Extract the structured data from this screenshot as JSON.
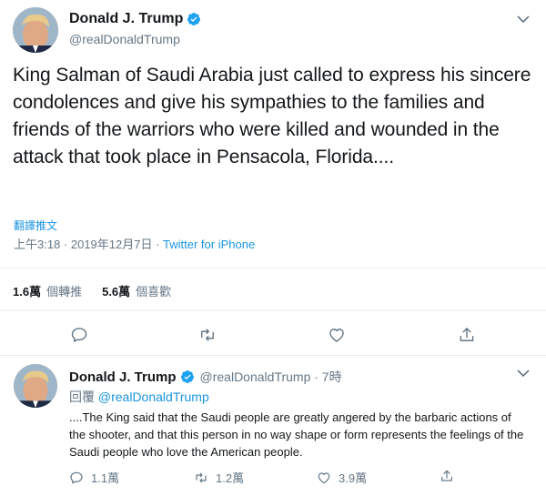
{
  "main_tweet": {
    "display_name": "Donald J. Trump",
    "handle": "@realDonaldTrump",
    "text": "King Salman of Saudi Arabia just called to express his sincere condolences and give his sympathies to the families and friends of the warriors who were killed and wounded in the attack that took place in Pensacola, Florida....",
    "translate_label": "翻譯推文",
    "timestamp": "上午3:18 · 2019年12月7日",
    "separator": " · ",
    "source": "Twitter for iPhone",
    "retweets": {
      "count": "1.6萬",
      "label": "個轉推"
    },
    "likes": {
      "count": "5.6萬",
      "label": "個喜歡"
    }
  },
  "reply_tweet": {
    "display_name": "Donald J. Trump",
    "handle_time": "@realDonaldTrump · 7時",
    "reply_prefix": "回覆 ",
    "reply_mention": "@realDonaldTrump",
    "text": "....The King said that the Saudi people are greatly angered by the barbaric actions of the shooter, and that this person in no way shape or form represents the feelings of the Saudi people who love the American people.",
    "reply_count": "1.1萬",
    "retweet_count": "1.2萬",
    "like_count": "3.9萬"
  },
  "icons": {
    "verified": "verified-badge-icon",
    "caret": "chevron-down-icon",
    "reply": "reply-icon",
    "retweet": "retweet-icon",
    "like": "heart-icon",
    "share": "share-icon"
  },
  "colors": {
    "link": "#1b95e0",
    "muted": "#657786",
    "text": "#14171a",
    "divider": "#e6ecf0"
  }
}
